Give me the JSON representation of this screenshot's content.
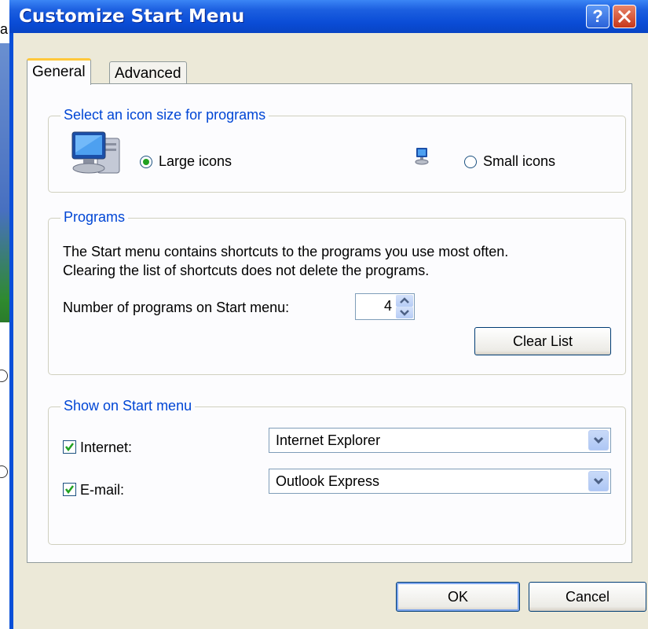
{
  "background": {
    "partial_text": "a"
  },
  "dialog": {
    "title": "Customize Start Menu",
    "help_label": "?",
    "tabs": [
      "General",
      "Advanced"
    ]
  },
  "icon_size": {
    "legend": "Select an icon size for programs",
    "large_label": "Large icons",
    "small_label": "Small icons",
    "selected": "Large icons"
  },
  "programs": {
    "legend": "Programs",
    "description_line1": "The Start menu contains shortcuts to the programs you use most often.",
    "description_line2": "Clearing the list of shortcuts does not delete the programs.",
    "count_label": "Number of programs on Start menu:",
    "count_value": "4",
    "clear_button": "Clear List"
  },
  "show_on_start": {
    "legend": "Show on Start menu",
    "internet_label": "Internet:",
    "internet_checked": true,
    "internet_value": "Internet Explorer",
    "email_label": "E-mail:",
    "email_checked": true,
    "email_value": "Outlook Express"
  },
  "buttons": {
    "ok": "OK",
    "cancel": "Cancel"
  },
  "colors": {
    "titlebar": "#0a4cd6",
    "group_label": "#0046d5",
    "dialog_face": "#ece9d8"
  }
}
